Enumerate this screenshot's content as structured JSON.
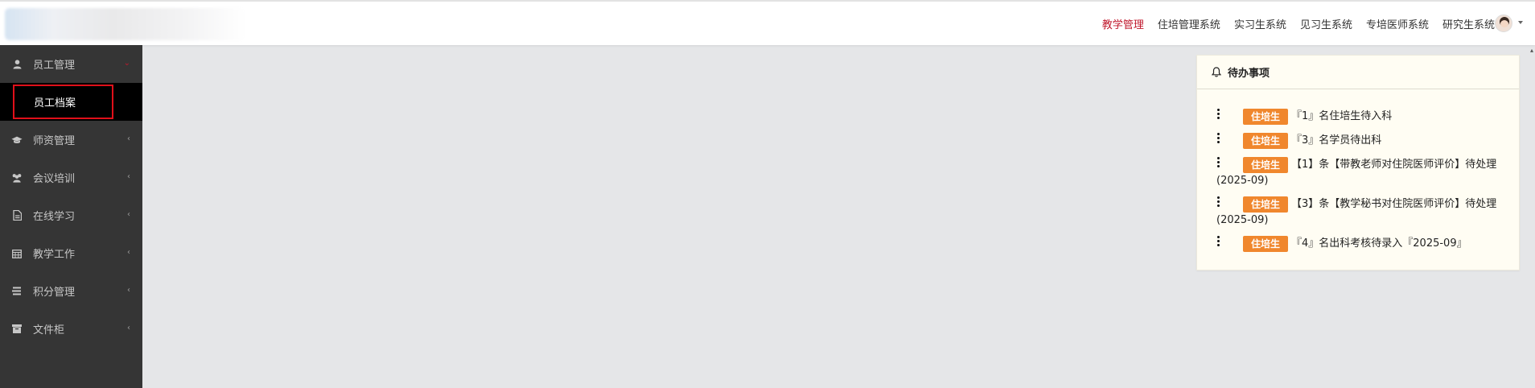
{
  "header": {
    "nav": [
      {
        "label": "教学管理",
        "active": true
      },
      {
        "label": "住培管理系统",
        "active": false
      },
      {
        "label": "实习生系统",
        "active": false
      },
      {
        "label": "见习生系统",
        "active": false
      },
      {
        "label": "专培医师系统",
        "active": false
      },
      {
        "label": "研究生系统",
        "active": false
      }
    ],
    "accent_color": "#c0182c"
  },
  "sidebar": {
    "items": [
      {
        "label": "员工管理",
        "icon": "user-icon",
        "expanded": true
      },
      {
        "label": "师资管理",
        "icon": "graduation-cap-icon"
      },
      {
        "label": "会议培训",
        "icon": "users-icon"
      },
      {
        "label": "在线学习",
        "icon": "document-icon"
      },
      {
        "label": "教学工作",
        "icon": "calendar-icon"
      },
      {
        "label": "积分管理",
        "icon": "list-icon"
      },
      {
        "label": "文件柜",
        "icon": "archive-icon"
      }
    ],
    "submenu": {
      "label": "员工档案"
    }
  },
  "todo": {
    "title": "待办事项",
    "badge_color": "#f0872d",
    "items": [
      {
        "badge": "住培生",
        "text": "『1』名住培生待入科"
      },
      {
        "badge": "住培生",
        "text": "『3』名学员待出科"
      },
      {
        "badge": "住培生",
        "text": "【1】条【带教老师对住院医师评价】待处理",
        "cont": "(2025-09)"
      },
      {
        "badge": "住培生",
        "text": "【3】条【教学秘书对住院医师评价】待处理",
        "cont": "(2025-09)"
      },
      {
        "badge": "住培生",
        "text": "『4』名出科考核待录入『2025-09』"
      }
    ]
  }
}
